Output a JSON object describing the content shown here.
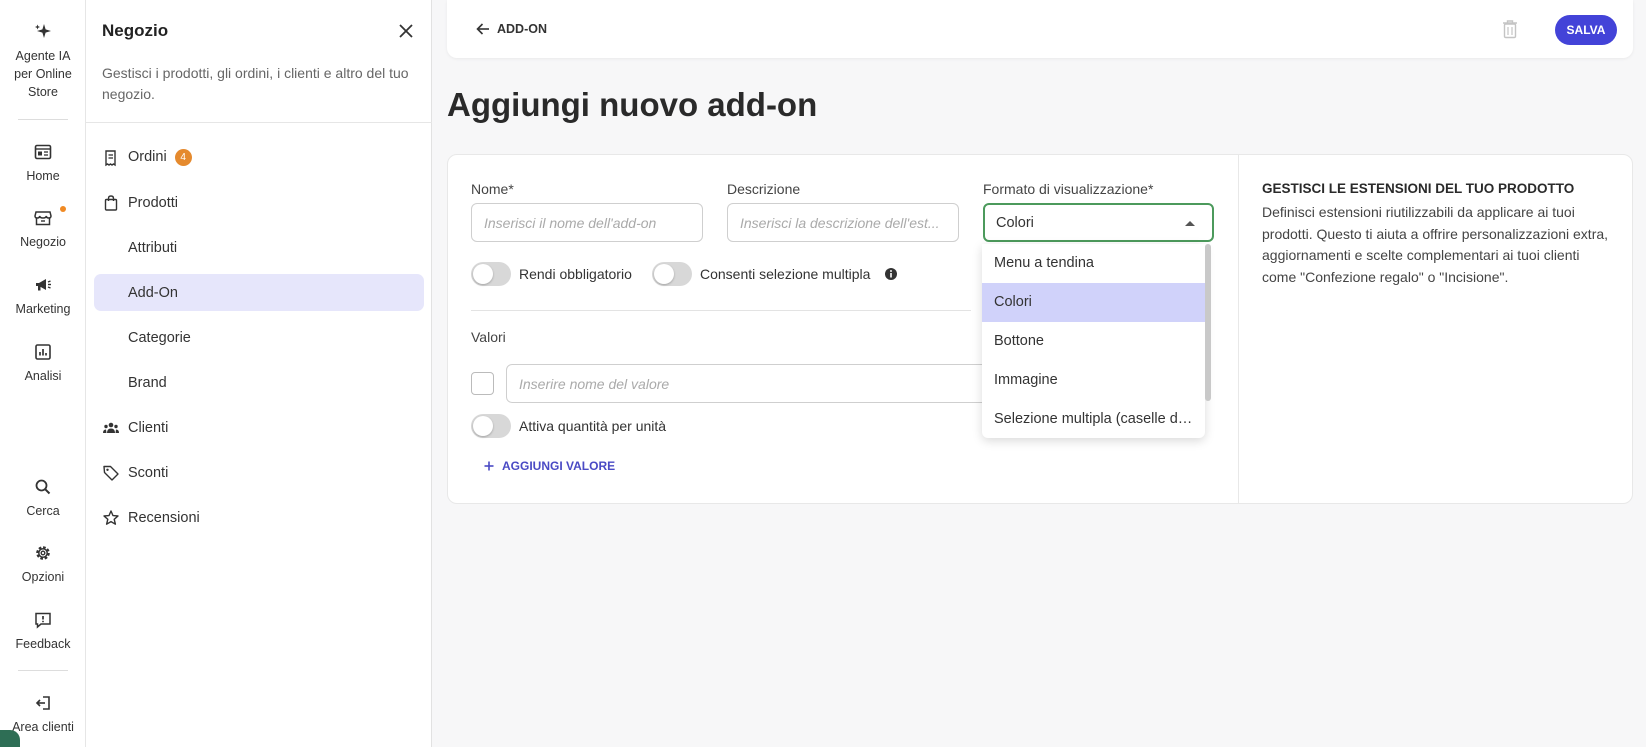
{
  "rail": {
    "ai_agent_label": "Agente IA per Online Store",
    "items": [
      {
        "label": "Home",
        "icon": "home-icon"
      },
      {
        "label": "Negozio",
        "icon": "store-icon"
      },
      {
        "label": "Marketing",
        "icon": "megaphone-icon"
      },
      {
        "label": "Analisi",
        "icon": "chart-icon"
      }
    ],
    "bottom": [
      {
        "label": "Cerca",
        "icon": "search-icon"
      },
      {
        "label": "Opzioni",
        "icon": "gear-icon"
      },
      {
        "label": "Feedback",
        "icon": "feedback-icon"
      },
      {
        "label": "Area clienti",
        "icon": "logout-icon"
      }
    ]
  },
  "panel": {
    "title": "Negozio",
    "description": "Gestisci i prodotti, gli ordini, i clienti e altro del tuo negozio.",
    "items": [
      {
        "label": "Ordini",
        "badge": "4"
      },
      {
        "label": "Prodotti"
      },
      {
        "label": "Attributi"
      },
      {
        "label": "Add-On",
        "active": true
      },
      {
        "label": "Categorie"
      },
      {
        "label": "Brand"
      },
      {
        "label": "Clienti"
      },
      {
        "label": "Sconti"
      },
      {
        "label": "Recensioni"
      }
    ]
  },
  "header": {
    "back_label": "ADD-ON",
    "save_label": "SALVA"
  },
  "page": {
    "title": "Aggiungi nuovo add-on"
  },
  "form": {
    "name_label": "Nome*",
    "name_placeholder": "Inserisci il nome dell'add-on",
    "description_label": "Descrizione",
    "description_placeholder": "Inserisci la descrizione dell'est...",
    "format_label": "Formato di visualizzazione*",
    "format_value": "Colori",
    "required_toggle_label": "Rendi obbligatorio",
    "multiple_toggle_label": "Consenti selezione multipla",
    "values_label": "Valori",
    "value_placeholder": "Inserire nome del valore",
    "quantity_toggle_label": "Attiva quantità per unità",
    "add_value_label": "AGGIUNGI VALORE"
  },
  "info": {
    "heading": "GESTISCI LE ESTENSIONI DEL TUO PRODOTTO",
    "text": "Definisci estensioni riutilizzabili da applicare ai tuoi prodotti. Questo ti aiuta a offrire personalizzazioni extra, aggiornamenti e scelte complementari ai tuoi clienti come \"Confezione regalo\" o \"Incisione\"."
  },
  "dropdown": {
    "options": [
      "Menu a tendina",
      "Colori",
      "Bottone",
      "Immagine",
      "Selezione multipla (caselle di..."
    ],
    "selected": "Colori"
  },
  "colors": {
    "accent": "#4343d8",
    "active_nav": "#e6e6fb",
    "selected_option": "#d0d2fa",
    "focus_border": "#4c9a5c",
    "badge": "#e58a2e"
  }
}
